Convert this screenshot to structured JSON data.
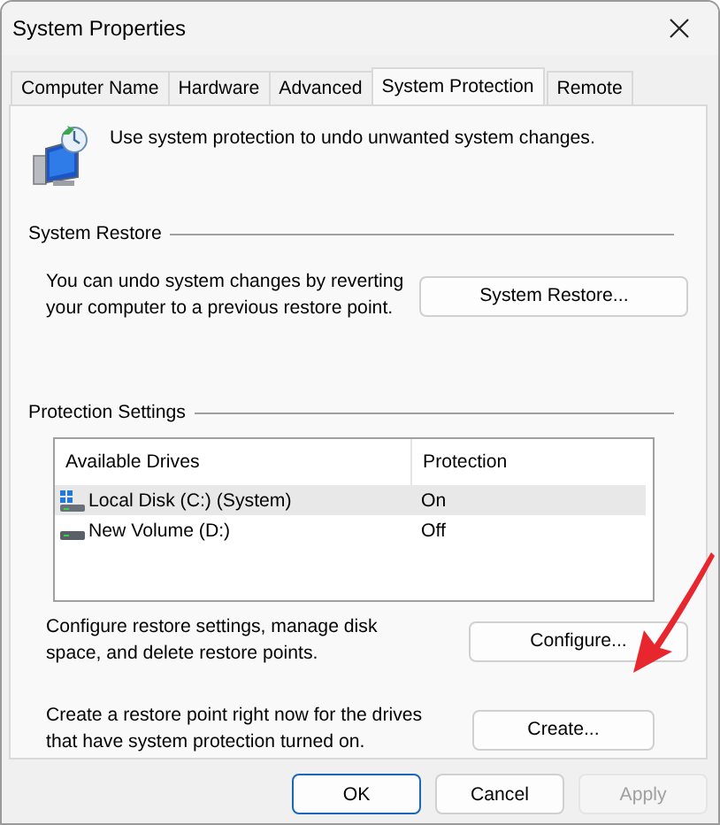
{
  "window": {
    "title": "System Properties"
  },
  "tabs": [
    {
      "label": "Computer Name",
      "selected": false
    },
    {
      "label": "Hardware",
      "selected": false
    },
    {
      "label": "Advanced",
      "selected": false
    },
    {
      "label": "System Protection",
      "selected": true
    },
    {
      "label": "Remote",
      "selected": false
    }
  ],
  "intro": "Use system protection to undo unwanted system changes.",
  "system_restore": {
    "heading": "System Restore",
    "description": "You can undo system changes by reverting your computer to a previous restore point.",
    "button": "System Restore..."
  },
  "protection_settings": {
    "heading": "Protection Settings",
    "columns": [
      "Available Drives",
      "Protection"
    ],
    "rows": [
      {
        "drive": "Local Disk (C:) (System)",
        "protection": "On",
        "kind": "system",
        "selected": true
      },
      {
        "drive": "New Volume (D:)",
        "protection": "Off",
        "kind": "volume",
        "selected": false
      }
    ],
    "configure": {
      "description": "Configure restore settings, manage disk space, and delete restore points.",
      "button": "Configure..."
    },
    "create": {
      "description": "Create a restore point right now for the drives that have system protection turned on.",
      "button": "Create..."
    }
  },
  "buttons": [
    {
      "label": "OK",
      "default": true,
      "disabled": false
    },
    {
      "label": "Cancel",
      "default": false,
      "disabled": false
    },
    {
      "label": "Apply",
      "default": false,
      "disabled": true
    }
  ]
}
